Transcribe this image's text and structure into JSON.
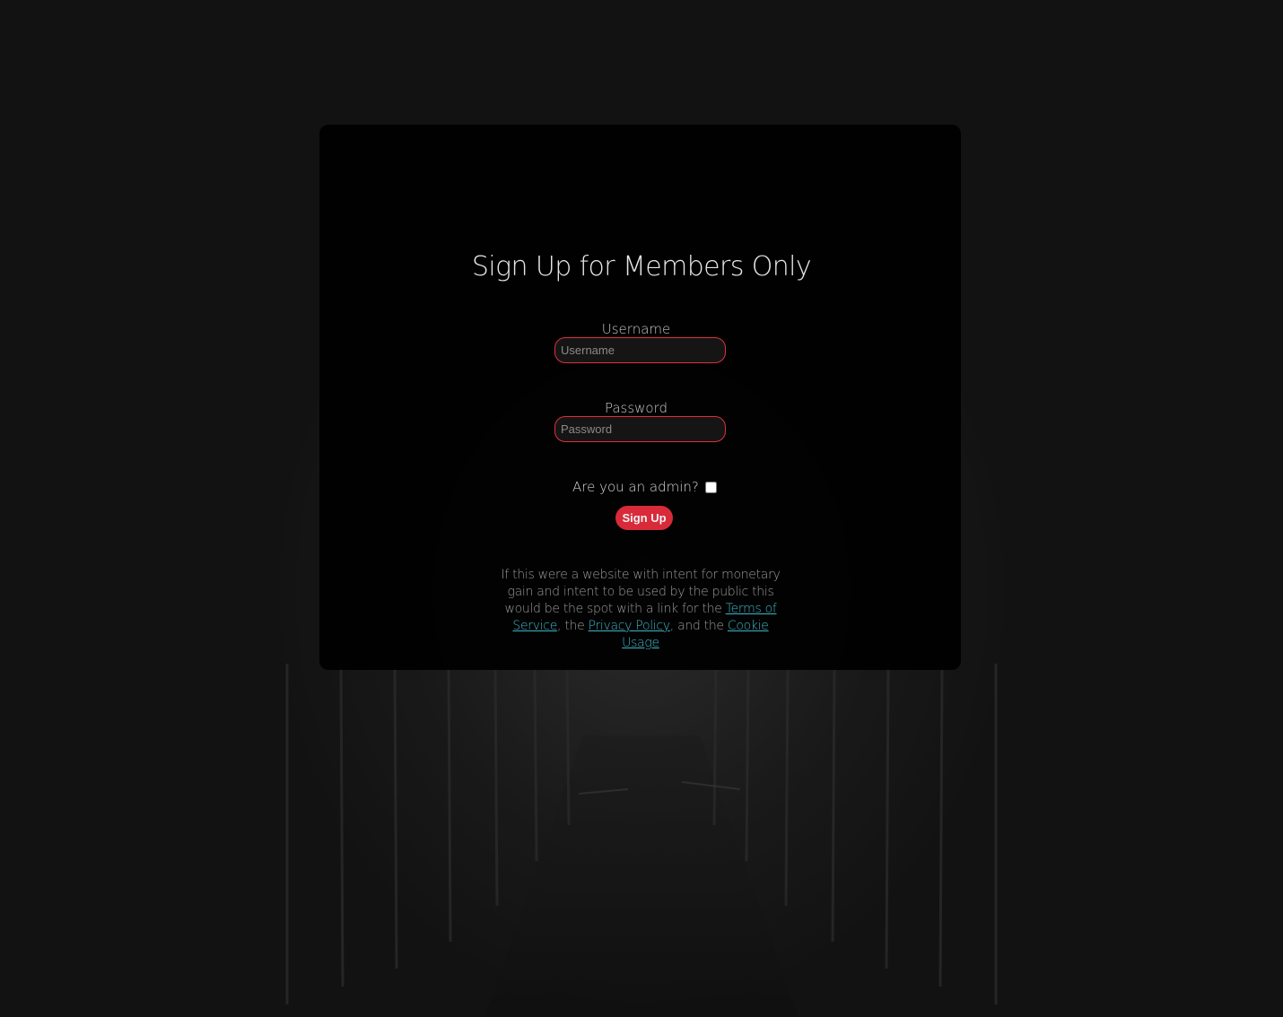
{
  "form": {
    "title": "Sign Up for Members Only",
    "username_label": "Username",
    "username_placeholder": "Username",
    "password_label": "Password",
    "password_placeholder": "Password",
    "admin_label": "Are you an admin?",
    "admin_checked": false,
    "submit_label": "Sign Up"
  },
  "legal": {
    "text_1": "If this were a website with intent for monetary gain and intent to be used by the public this would be the spot with a link for the ",
    "terms_link": "Terms of Service",
    "text_2": ", the ",
    "privacy_link": "Privacy Policy",
    "text_3": ", and the ",
    "cookie_link": "Cookie Usage"
  },
  "colors": {
    "accent": "#d92a3a",
    "input_border": "#e0303f",
    "link": "#3fb4c4",
    "background": "#121212",
    "card": "#000000"
  },
  "background_image": "dark-gothic-cloister-corridor"
}
